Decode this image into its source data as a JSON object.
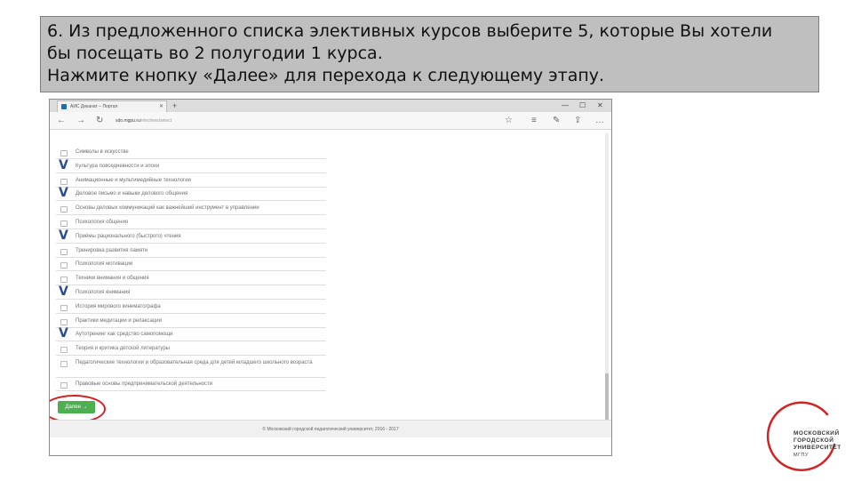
{
  "instruction": {
    "line1": "6. Из предложенного списка элективных курсов выберите 5, которые Вы хотели",
    "line2": "бы посещать во 2 полугодии 1 курса.",
    "line3": "Нажмите кнопку «Далее» для перехода к следующему этапу."
  },
  "browser": {
    "tab_title": "АИС Деканат – Портал",
    "address_host": "sdo.mgpu.ru",
    "address_path": "/electives/select",
    "new_tab": "+",
    "controls": {
      "minimize": "—",
      "maximize": "☐",
      "close": "✕"
    },
    "nav": {
      "back": "←",
      "forward": "→",
      "refresh": "↻",
      "home": "⌂",
      "star": "☆",
      "hub": "≡",
      "notes": "✎",
      "share": "⇪",
      "more": "…"
    }
  },
  "courses": [
    {
      "label": "Символы в искусстве",
      "checked": false
    },
    {
      "label": "Культура повседневности и эпохи",
      "checked": true
    },
    {
      "label": "Анимационные и мультимедийные технологии",
      "checked": false
    },
    {
      "label": "Деловое письмо и навыки делового общения",
      "checked": true
    },
    {
      "label": "Основы деловых коммуникаций как важнейший инструмент в управлении",
      "checked": false
    },
    {
      "label": "Психология общения",
      "checked": false
    },
    {
      "label": "Приёмы рационального (быстрого) чтения",
      "checked": true
    },
    {
      "label": "Тренировка развития памяти",
      "checked": false
    },
    {
      "label": "Психология мотивации",
      "checked": false
    },
    {
      "label": "Техники внимания и общения",
      "checked": false
    },
    {
      "label": "Психология внимания",
      "checked": true
    },
    {
      "label": "История мирового кинематографа",
      "checked": false
    },
    {
      "label": "Практики медитации и релаксации",
      "checked": false
    },
    {
      "label": "Аутотренинг как средство самопомощи",
      "checked": true
    },
    {
      "label": "Теория и критика детской литературы",
      "checked": false
    },
    {
      "label": "Педагогические технологии и образовательная среда для детей младшего школьного возраста",
      "checked": false,
      "tall": true
    },
    {
      "label": "Правовые основы предпринимательской деятельности",
      "checked": false
    }
  ],
  "check_mark": "V",
  "next_button": "Далее →",
  "footer": "© Московский городской педагогический университет, 2016 - 2017",
  "logo": {
    "line1": "МОСКОВСКИЙ",
    "line2": "ГОРОДСКОЙ",
    "line3": "УНИВЕРСИТЕТ",
    "line4": "МГПУ",
    "color": "#d42121"
  },
  "colors": {
    "banner_bg": "#bfbfbf",
    "next_button": "#4caf50",
    "highlight_ellipse": "#d42121",
    "check_mark": "#2b4c8f"
  }
}
